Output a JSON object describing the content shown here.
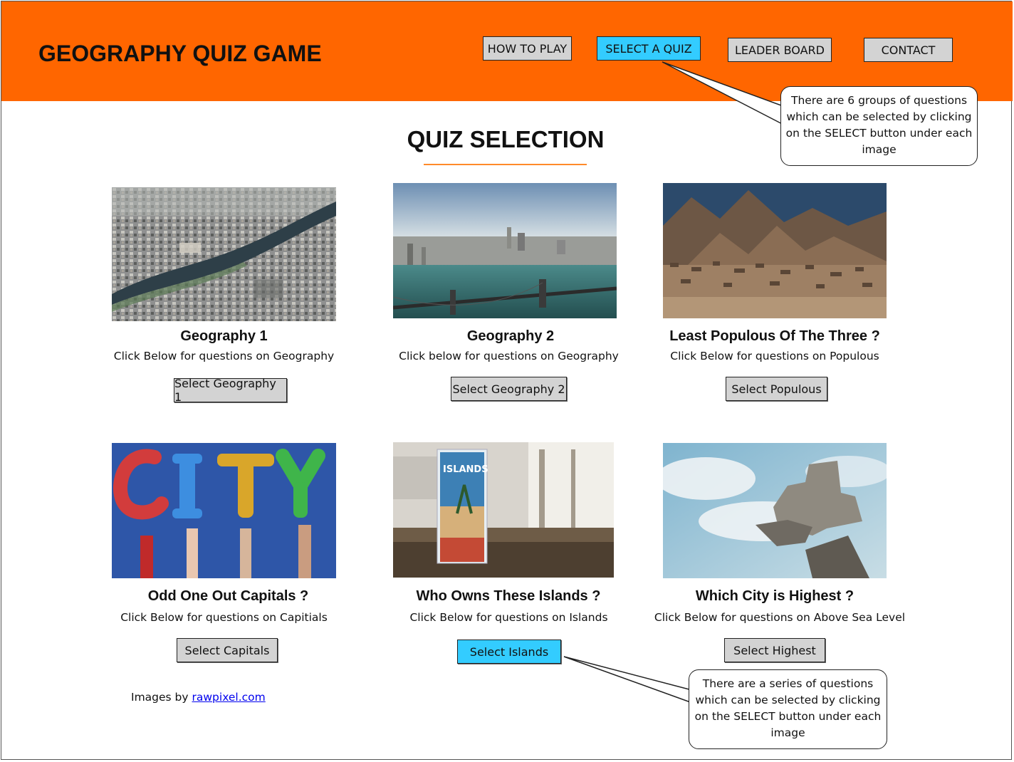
{
  "header": {
    "title": "GEOGRAPHY QUIZ GAME",
    "nav": [
      {
        "label": "HOW TO PLAY",
        "active": false
      },
      {
        "label": "SELECT A QUIZ",
        "active": true
      },
      {
        "label": "LEADER BOARD",
        "active": false
      },
      {
        "label": "CONTACT",
        "active": false
      }
    ],
    "accent_color": "#ff6600",
    "active_color": "#33ccff"
  },
  "main": {
    "section_title": "QUIZ SELECTION",
    "cards": [
      {
        "title": "Geography 1",
        "desc": "Click Below for questions on Geography",
        "button": "Select Geography 1",
        "image": "aerial-city-river-photo",
        "active": false
      },
      {
        "title": "Geography 2",
        "desc": "Click below for questions on Geography",
        "button": "Select Geography 2",
        "image": "new-york-bridge-photo",
        "active": false
      },
      {
        "title": "Least Populous Of The Three ?",
        "desc": "Click Below for questions on Populous",
        "button": "Select Populous",
        "image": "mountain-village-photo",
        "active": false
      },
      {
        "title": "Odd One Out Capitals ?",
        "desc": "Click Below for questions on Capitials",
        "button": "Select Capitals",
        "image": "city-balloons-photo",
        "active": false
      },
      {
        "title": "Who Owns These Islands ?",
        "desc": "Click Below for questions on Islands",
        "button": "Select Islands",
        "image": "islands-brochure-photo",
        "active": true
      },
      {
        "title": "Which City is Highest ?",
        "desc": "Click Below for questions on Above Sea Level",
        "button": "Select Highest",
        "image": "rock-tower-sky-photo",
        "active": false
      }
    ],
    "credit_prefix": "Images by ",
    "credit_link": "rawpixel.com"
  },
  "callouts": [
    {
      "text": "There are 6 groups of questions which can be selected by clicking on the SELECT button under each image"
    },
    {
      "text": "There are a series of questions which can be selected by clicking on the SELECT button under each image"
    }
  ]
}
